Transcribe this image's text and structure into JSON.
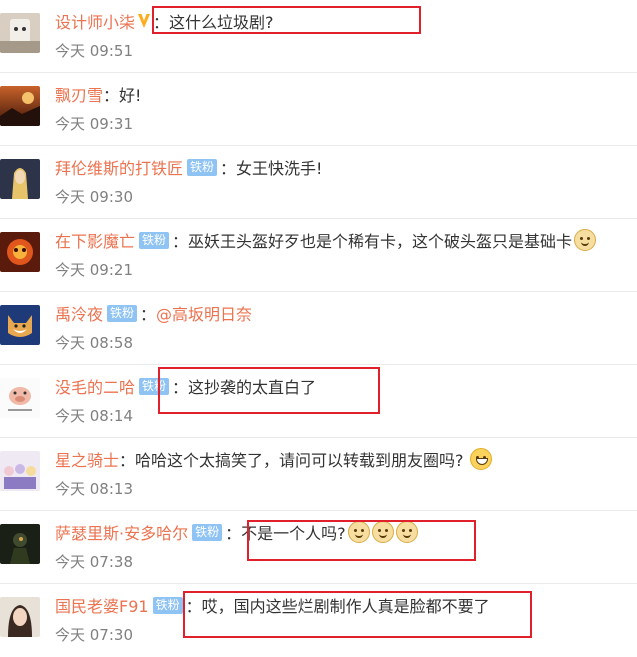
{
  "colors": {
    "name": "#eb7350",
    "badge": "#8fc3f3",
    "highlight": "#e0202b",
    "time": "#808080"
  },
  "comments": [
    {
      "user": "设计师小柒",
      "badge": "",
      "vip": true,
      "text": "这什么垃圾剧?",
      "time": "今天 09:51"
    },
    {
      "user": "飘刃雪",
      "badge": "",
      "text": "好!",
      "time": "今天 09:31"
    },
    {
      "user": "拜伦维斯的打铁匠",
      "badge": "铁粉",
      "text": "女王快洗手!",
      "time": "今天 09:30"
    },
    {
      "user": "在下影魔亡",
      "badge": "铁粉",
      "text": "巫妖王头盔好歹也是个稀有卡，这个破头盔只是基础卡",
      "time": "今天 09:21",
      "emoji": "dog-icon"
    },
    {
      "user": "禹泠夜",
      "badge": "铁粉",
      "text": "@高坂明日奈",
      "time": "今天 08:58"
    },
    {
      "user": "没毛的二哈",
      "badge": "铁粉",
      "text": "这抄袭的太直白了",
      "time": "今天 08:14"
    },
    {
      "user": "星之骑士",
      "badge": "",
      "text": "哈哈这个太搞笑了，请问可以转载到朋友圈吗?",
      "time": "今天 08:13",
      "emoji": "grin-icon"
    },
    {
      "user": "萨瑟里斯·安多哈尔",
      "badge": "铁粉",
      "text": "不是一个人吗?",
      "time": "今天 07:38",
      "emoji": "dog-icon x3"
    },
    {
      "user": "国民老婆F91",
      "badge": "铁粉",
      "text": "哎，国内这些烂剧制作人真是脸都不要了",
      "time": "今天 07:30"
    }
  ]
}
